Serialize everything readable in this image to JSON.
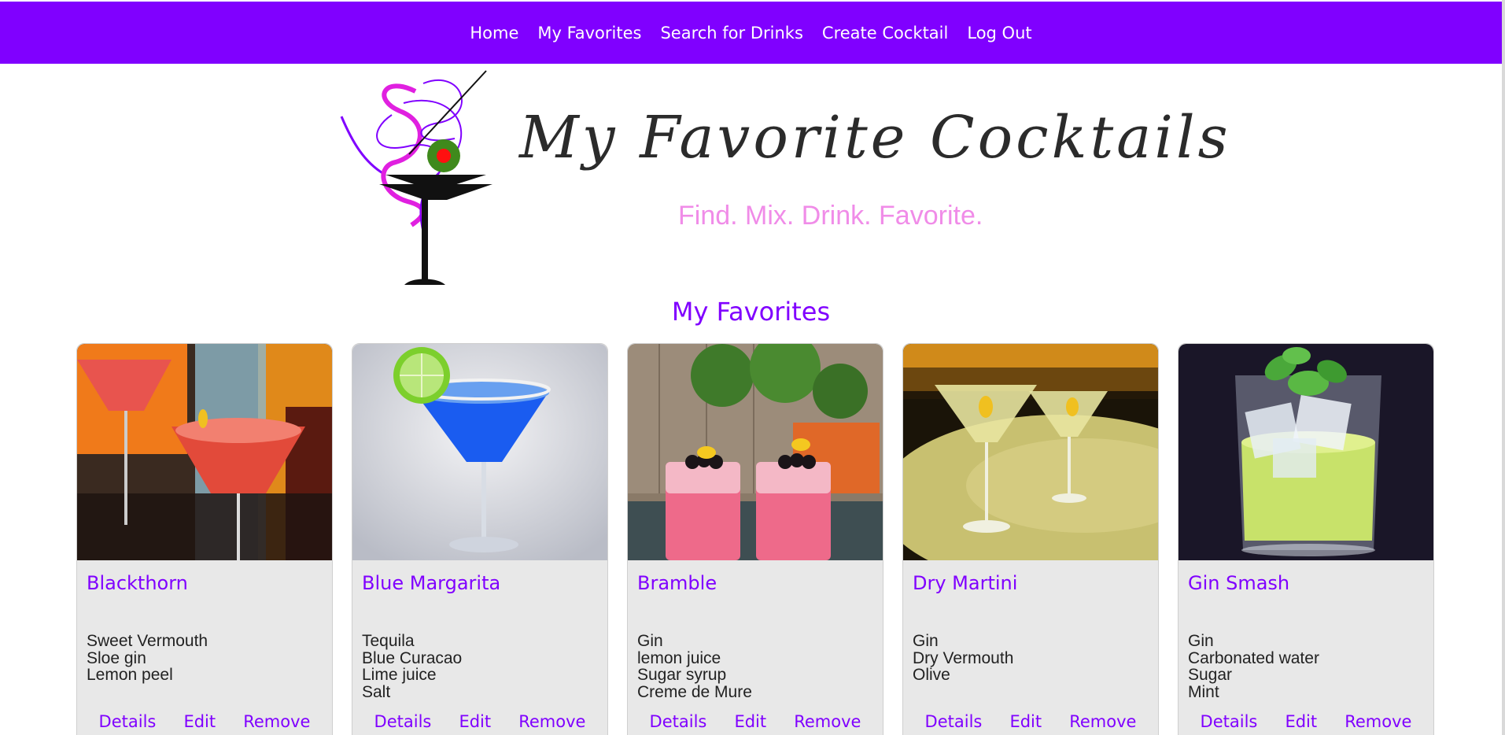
{
  "nav": {
    "items": [
      {
        "label": "Home"
      },
      {
        "label": "My Favorites"
      },
      {
        "label": "Search for Drinks"
      },
      {
        "label": "Create Cocktail"
      },
      {
        "label": "Log Out"
      }
    ]
  },
  "brand": {
    "title": "My Favorite Cocktails",
    "tagline": "Find. Mix. Drink. Favorite."
  },
  "section": {
    "heading": "My Favorites"
  },
  "actions": {
    "details_label": "Details",
    "edit_label": "Edit",
    "remove_label": "Remove"
  },
  "cards": [
    {
      "name": "Blackthorn",
      "ingredients": [
        "Sweet Vermouth",
        "Sloe gin",
        "Lemon peel"
      ]
    },
    {
      "name": "Blue Margarita",
      "ingredients": [
        "Tequila",
        "Blue Curacao",
        "Lime juice",
        "Salt"
      ]
    },
    {
      "name": "Bramble",
      "ingredients": [
        "Gin",
        "lemon juice",
        "Sugar syrup",
        "Creme de Mure"
      ]
    },
    {
      "name": "Dry Martini",
      "ingredients": [
        "Gin",
        "Dry Vermouth",
        "Olive"
      ]
    },
    {
      "name": "Gin Smash",
      "ingredients": [
        "Gin",
        "Carbonated water",
        "Sugar",
        "Mint"
      ]
    }
  ],
  "colors": {
    "nav_background": "#8000ff",
    "accent": "#8000ff",
    "tagline": "#f08ce8",
    "card_background": "#e8e8e8"
  }
}
